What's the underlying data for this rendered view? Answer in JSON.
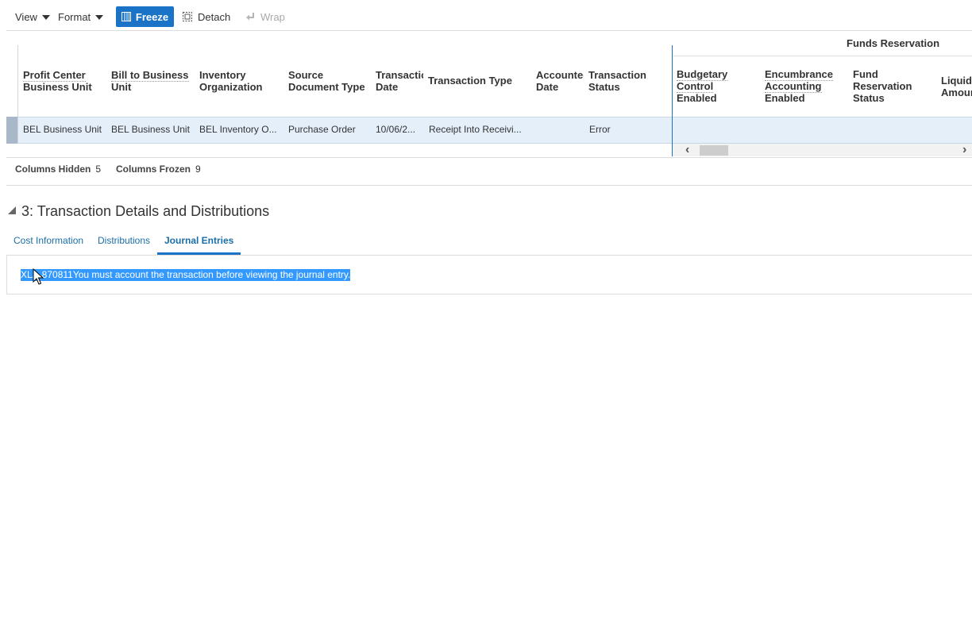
{
  "toolbar": {
    "view_label": "View",
    "format_label": "Format",
    "freeze_label": "Freeze",
    "detach_label": "Detach",
    "wrap_label": "Wrap"
  },
  "table": {
    "group_header": "Funds Reservation",
    "columns": [
      "Profit Center\nBusiness Unit",
      "Bill to Business\nUnit",
      "Inventory\nOrganization",
      "Source\nDocument Type",
      "Transaction\nDate",
      "Transaction Type",
      "Accounted\nDate",
      "Transaction\nStatus",
      "Budgetary\nControl\nEnabled",
      "Encumbrance\nAccounting\nEnabled",
      "Fund\nReservation\nStatus",
      "Liquidation\nAmount"
    ],
    "row": [
      "BEL Business Unit",
      "BEL Business Unit",
      "BEL Inventory O...",
      "Purchase Order",
      "10/06/2...",
      "Receipt Into Receivi...",
      "",
      "Error"
    ]
  },
  "stats": {
    "hidden_label": "Columns Hidden",
    "hidden_value": "5",
    "frozen_label": "Columns Frozen",
    "frozen_value": "9"
  },
  "section": {
    "title": "3: Transaction Details and Distributions",
    "tabs": [
      "Cost Information",
      "Distributions",
      "Journal Entries"
    ],
    "active_tab": "Journal Entries",
    "message": "XLA-870811You must account the transaction before viewing the journal entry."
  },
  "colors": {
    "accent": "#1a73c7",
    "selected_row": "#e4effa",
    "text_selection": "#3399ff"
  }
}
